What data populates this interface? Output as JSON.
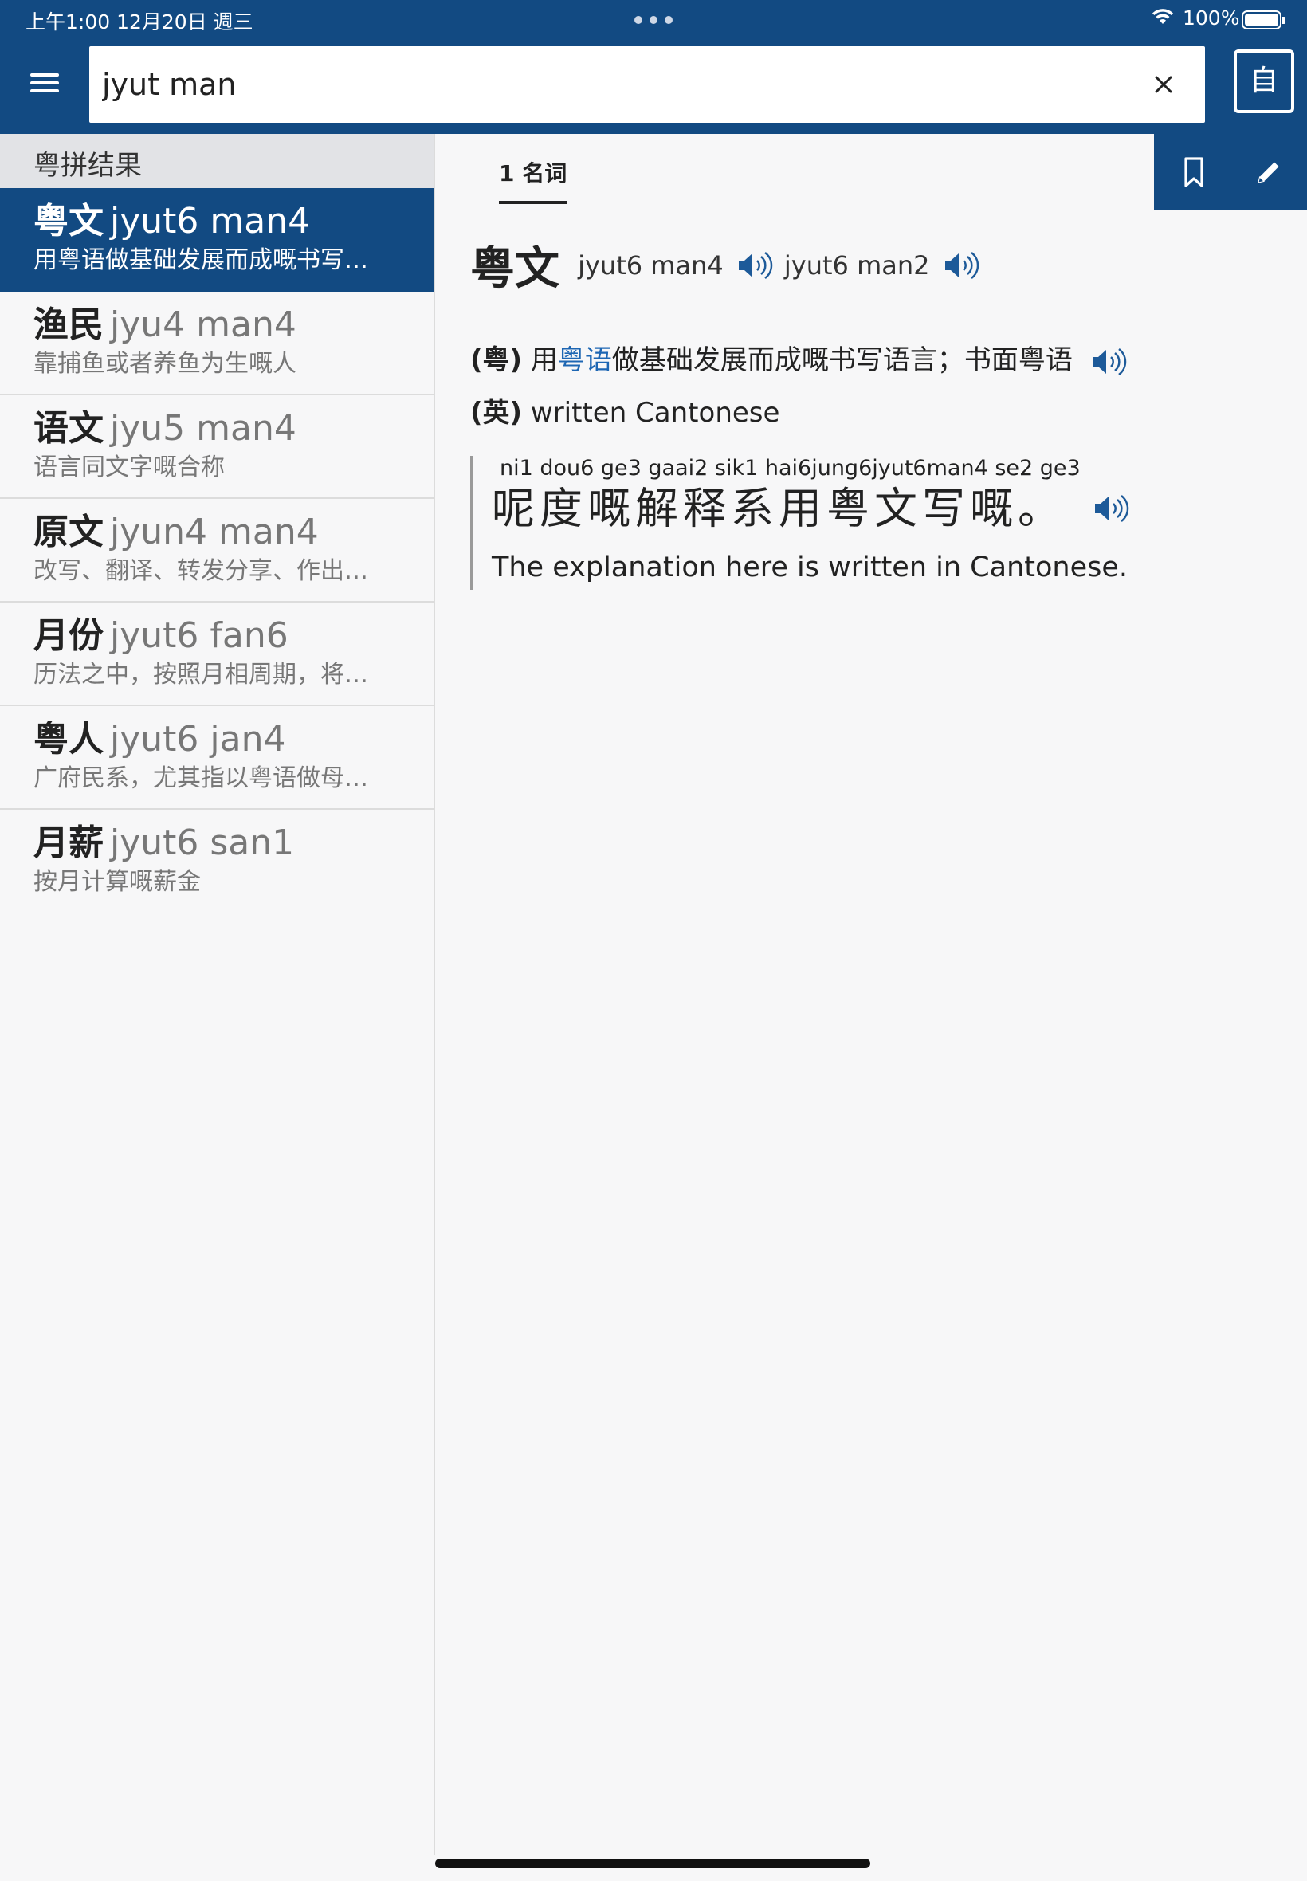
{
  "status_bar": {
    "time": "上午1:00   12月20日 週三",
    "battery": "100%"
  },
  "search": {
    "value": "jyut man",
    "mode_button": "自"
  },
  "sidebar": {
    "section_title": "粤拼结果",
    "results": [
      {
        "word": "粤文",
        "jyutping": "jyut6 man4",
        "gloss": "用粤语做基础发展而成嘅书写…"
      },
      {
        "word": "渔民",
        "jyutping": "jyu4 man4",
        "gloss": "靠捕鱼或者养鱼为生嘅人"
      },
      {
        "word": "语文",
        "jyutping": "jyu5 man4",
        "gloss": "语言同文字嘅合称"
      },
      {
        "word": "原文",
        "jyutping": "jyun4 man4",
        "gloss": "改写、翻译、转发分享、作出…"
      },
      {
        "word": "月份",
        "jyutping": "jyut6 fan6",
        "gloss": "历法之中，按照月相周期，将…"
      },
      {
        "word": "粤人",
        "jyutping": "jyut6 jan4",
        "gloss": "广府民系，尤其指以粤语做母…"
      },
      {
        "word": "月薪",
        "jyutping": "jyut6 san1",
        "gloss": "按月计算嘅薪金"
      }
    ]
  },
  "entry": {
    "pos_tab": "1 名词",
    "word": "粤文",
    "pronunciations": [
      "jyut6 man4",
      "jyut6 man2"
    ],
    "yue_label": "(粤)",
    "yue_def_pre": "用",
    "yue_def_link": "粤语",
    "yue_def_post": "做基础发展而成嘅书写语言；书面粤语",
    "eng_label": "(英)",
    "eng_def": "written Cantonese",
    "example": {
      "jyutping": "ni1  dou6 ge3 gaai2 sik1 hai6jung6jyut6man4 se2  ge3",
      "text": "呢度嘅解释系用粤文写嘅。",
      "translation": "The explanation here is written in Cantonese."
    }
  },
  "colors": {
    "primary": "#124a82",
    "link": "#1d66b3",
    "sidebar_header": "#e2e3e6"
  },
  "icons": [
    "menu-icon",
    "close-icon",
    "bookmark-icon",
    "pencil-icon",
    "speaker-icon",
    "wifi-icon",
    "battery-icon"
  ]
}
